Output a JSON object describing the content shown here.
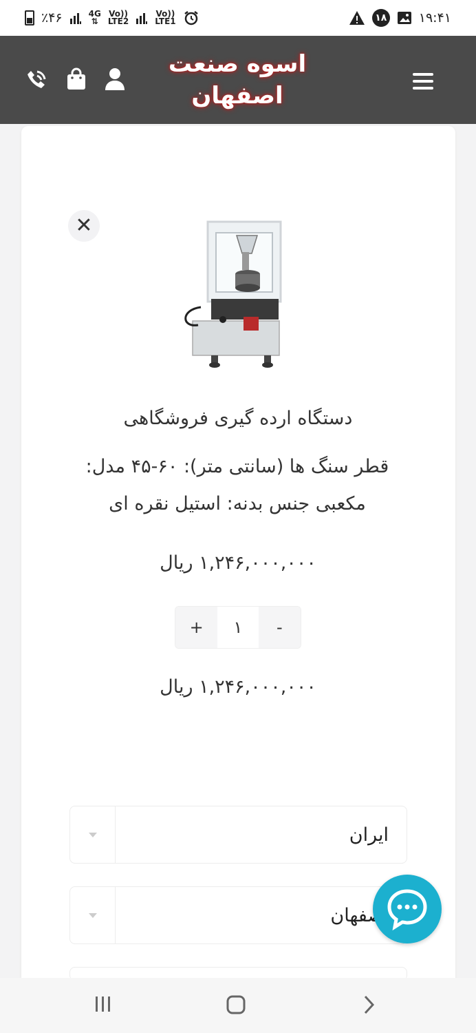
{
  "status_bar": {
    "time": "۱۹:۴۱",
    "notification_count": "۱۸",
    "battery": "٪۴۶",
    "net1": "4G",
    "net2_top": "Vo))",
    "net2_bottom": "LTE2",
    "net3_top": "Vo))",
    "net3_bottom": "LTE1"
  },
  "header": {
    "brand_line1": "اسوه صنعت",
    "brand_line2": "اصفهان"
  },
  "product": {
    "title": "دستگاه ارده گیری فروشگاهی",
    "spec_line1": "قطر سنگ ها (سانتی متر):  ۶۰-۴۵   مدل:",
    "spec_line2": "مکعبی   جنس بدنه:  استیل نقره ای",
    "unit_price": "۱,۲۴۶,۰۰۰,۰۰۰ ریال",
    "total_price": "۱,۲۴۶,۰۰۰,۰۰۰ ریال"
  },
  "quantity": {
    "plus": "+",
    "value": "۱",
    "minus": "-"
  },
  "form": {
    "country": "ایران",
    "province": "اصفهان"
  },
  "colors": {
    "header_bg": "#4a4a4a",
    "brand_glow": "#c21d1d",
    "chat_fab": "#1cb0cf"
  },
  "icons": [
    "menu-icon",
    "user-icon",
    "bag-icon",
    "phone-icon",
    "close-icon",
    "chat-icon",
    "recent-apps-icon",
    "home-icon",
    "back-icon"
  ]
}
